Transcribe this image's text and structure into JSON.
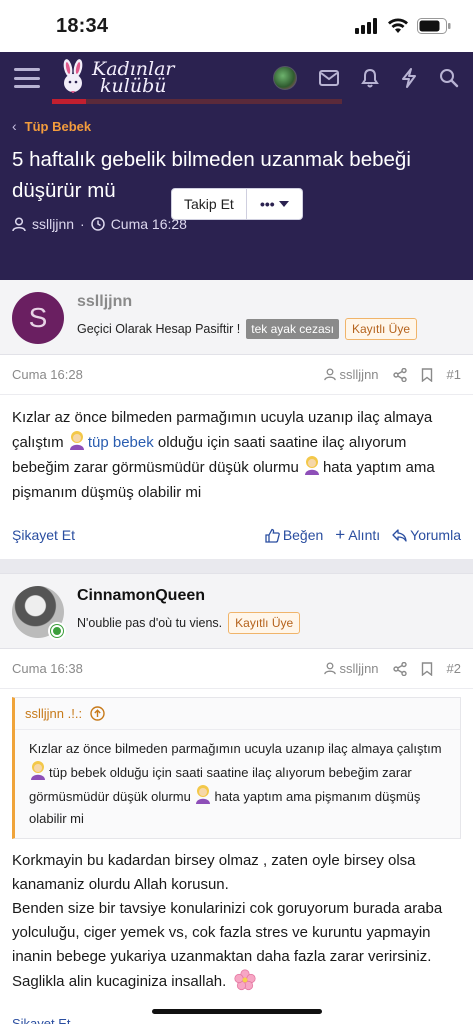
{
  "status": {
    "time": "18:34"
  },
  "header": {
    "logo_line1": "Kadınlar",
    "logo_line2": "kulübü"
  },
  "thread": {
    "breadcrumb": "Tüp Bebek",
    "title": "5 haftalık gebelik bilmeden uzanmak bebeği düşürür mü",
    "author": "ssllјjnn",
    "date": "Cuma 16:28",
    "follow_label": "Takip Et",
    "more_label": "•••"
  },
  "post1": {
    "avatar_letter": "S",
    "username": "sslljjnn",
    "user_title": "Geçici Olarak Hesap Pasiftir !",
    "badge_penalty": "tek ayak cezası",
    "badge_role": "Kayıtlı Üye",
    "time": "Cuma 16:28",
    "meta_user": "sslljjnn",
    "number": "#1",
    "text_a": "Kızlar az önce bilmeden parmağımın ucuyla uzanıp ilaç almaya çalıştım ",
    "text_link": "tüp bebek",
    "text_b": " olduğu için saati saatine ilaç alıyorum bebeğim zarar görmüsmüdür düşük olurmu ",
    "text_c": "hata yaptım ama pişmanım düşmüş olabilir mi",
    "report": "Şikayet Et",
    "like": "Beğen",
    "quote": "Alıntı",
    "reply": "Yorumla"
  },
  "post2": {
    "username": "CinnamonQueen",
    "user_title": "N'oublie pas d'où tu viens.",
    "badge_role": "Kayıtlı Üye",
    "time": "Cuma 16:38",
    "meta_user": "sslljjnn",
    "number": "#2",
    "quote_author": "sslljjnn .!.:",
    "quote_a": "Kızlar az önce bilmeden parmağımın ucuyla uzanıp ilaç almaya çalıştım ",
    "quote_b": "tüp bebek olduğu için saati saatine ilaç alıyorum bebeğim zarar görmüsmüdür düşük olurmu ",
    "quote_c": "hata yaptım ama pişmanım düşmüş olabilir mi",
    "body_1": "Korkmayin bu kadardan birsey olmaz , zaten oyle birsey olsa kanamaniz olurdu Allah korusun.",
    "body_2": "Benden size bir tavsiye konularinizi cok goruyorum burada araba yolculuğu, ciger yemek vs, cok fazla stres ve kuruntu yapmayin inanin bebege yukariya uzanmaktan daha fazla zarar verirsiniz.",
    "body_3": "Saglikla alin kucaginiza insallah.",
    "footer_cut": "Şikayet Et"
  }
}
